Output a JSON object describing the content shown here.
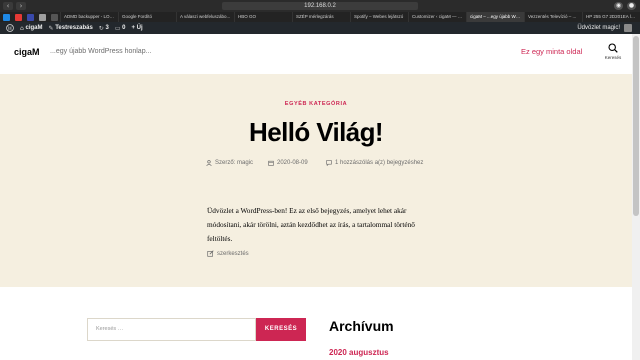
{
  "browser": {
    "back_icon": "chevron-left-icon",
    "forward_icon": "chevron-right-icon",
    "url": "192.168.0.2",
    "tabs": [
      "ADMD backupper - LOS...",
      "Google Fordító",
      "A válaszi webfeluszábo...",
      "HBO GO",
      "SZÉP mérlegzárás",
      "Spotify – Webes lejátszó",
      "Customizer ‹ cigaM — W...",
      "cigaM – ...egy újabb Wor...",
      "Vezzentés Televízió – ...",
      "HP 255 G7 2D201EA lapt..."
    ],
    "active_tab_index": 7
  },
  "admin_bar": {
    "site_name": "cigaM",
    "customize_label": "Testreszabás",
    "updates_count": "3",
    "comments_count": "0",
    "new_label": "+ Új",
    "greeting": "Üdvözlet magic!"
  },
  "site": {
    "title": "cigaM",
    "description": "...egy újabb WordPress honlap...",
    "nav_link": "Ez egy minta oldal",
    "search_toggle_label": "Keresés"
  },
  "post": {
    "category": "EGYÉB KATEGÓRIA",
    "title": "Helló Világ!",
    "author": "Szerző: magic",
    "date": "2020-08-09",
    "comments": "1 hozzászólás a(z) bejegyzéshez",
    "content": "Üdvözlet a WordPress-ben! Ez az első bejegyzés, amelyet lehet akár módosítani, akár törölni, aztán kezdődhet az írás, a tartalommal történő feltöltés.",
    "edit_label": "szerkesztés"
  },
  "widgets": {
    "search_placeholder": "Keresés …",
    "search_button": "KERESÉS",
    "archive_title": "Archívum",
    "archive_link": "2020 augusztus"
  },
  "colors": {
    "accent": "#cd2653",
    "header_bg": "#f5efe0",
    "admin_bar_bg": "#23282d"
  }
}
